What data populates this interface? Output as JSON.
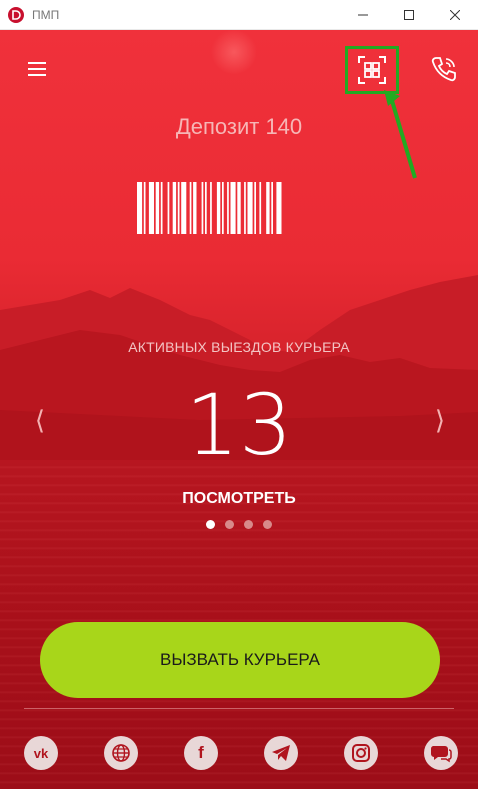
{
  "window": {
    "title": "ПМП"
  },
  "header": {
    "menu_icon": "hamburger-icon",
    "qr_icon": "qr-code-icon",
    "phone_icon": "phone-icon",
    "highlight_color": "#22aa22"
  },
  "deposit": {
    "label": "Депозит 140"
  },
  "stats": {
    "label": "АКТИВНЫХ ВЫЕЗДОВ КУРЬЕРА",
    "count": "13",
    "view_label": "ПОСМОТРЕТЬ",
    "prev_glyph": "⟨",
    "next_glyph": "⟩",
    "pages": 4,
    "active_page": 1
  },
  "cta": {
    "label": "ВЫЗВАТЬ КУРЬЕРА",
    "color": "#a8d61a"
  },
  "socials": [
    {
      "name": "vk-icon",
      "text": "vk"
    },
    {
      "name": "globe-icon"
    },
    {
      "name": "facebook-icon",
      "text": "f"
    },
    {
      "name": "telegram-icon"
    },
    {
      "name": "instagram-icon"
    },
    {
      "name": "chat-icon"
    }
  ],
  "colors": {
    "accent": "#e52d35",
    "dark_accent": "#a80f1a"
  }
}
